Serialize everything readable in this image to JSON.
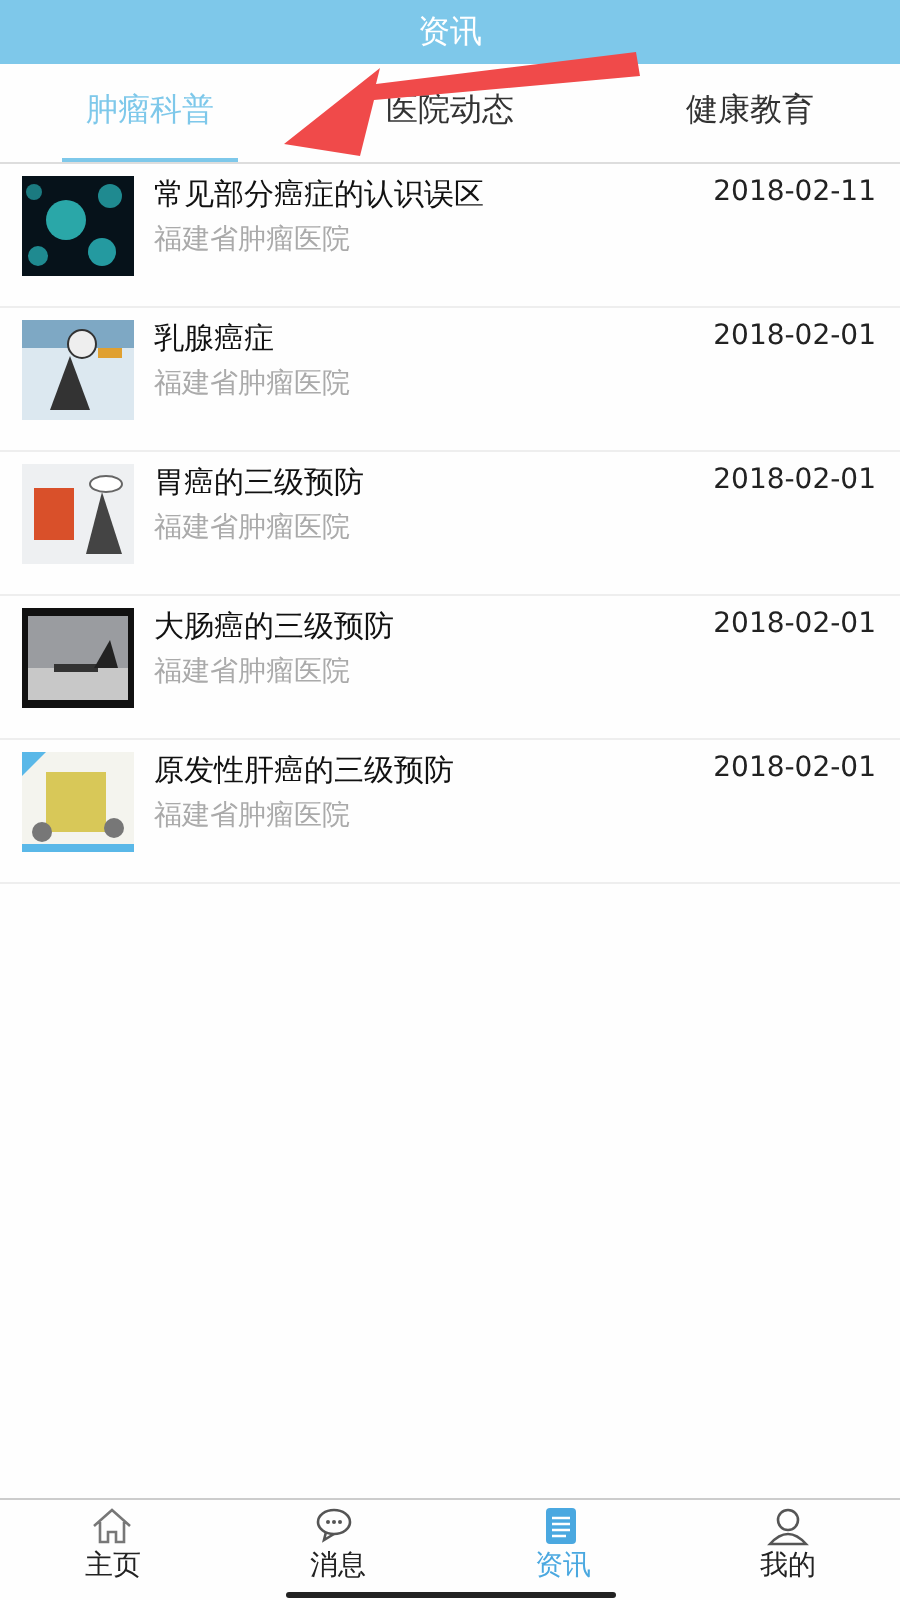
{
  "header": {
    "title": "资讯"
  },
  "tabs": [
    {
      "label": "肿瘤科普",
      "selected": true
    },
    {
      "label": "医院动态",
      "selected": false
    },
    {
      "label": "健康教育",
      "selected": false
    }
  ],
  "articles": [
    {
      "title": "常见部分癌症的认识误区",
      "source": "福建省肿瘤医院",
      "date": "2018-02-11"
    },
    {
      "title": "乳腺癌症",
      "source": "福建省肿瘤医院",
      "date": "2018-02-01"
    },
    {
      "title": "胃癌的三级预防",
      "source": "福建省肿瘤医院",
      "date": "2018-02-01"
    },
    {
      "title": "大肠癌的三级预防",
      "source": "福建省肿瘤医院",
      "date": "2018-02-01"
    },
    {
      "title": "原发性肝癌的三级预防",
      "source": "福建省肿瘤医院",
      "date": "2018-02-01"
    }
  ],
  "bottom_nav": [
    {
      "label": "主页",
      "selected": false
    },
    {
      "label": "消息",
      "selected": false
    },
    {
      "label": "资讯",
      "selected": true
    },
    {
      "label": "我的",
      "selected": false
    }
  ]
}
